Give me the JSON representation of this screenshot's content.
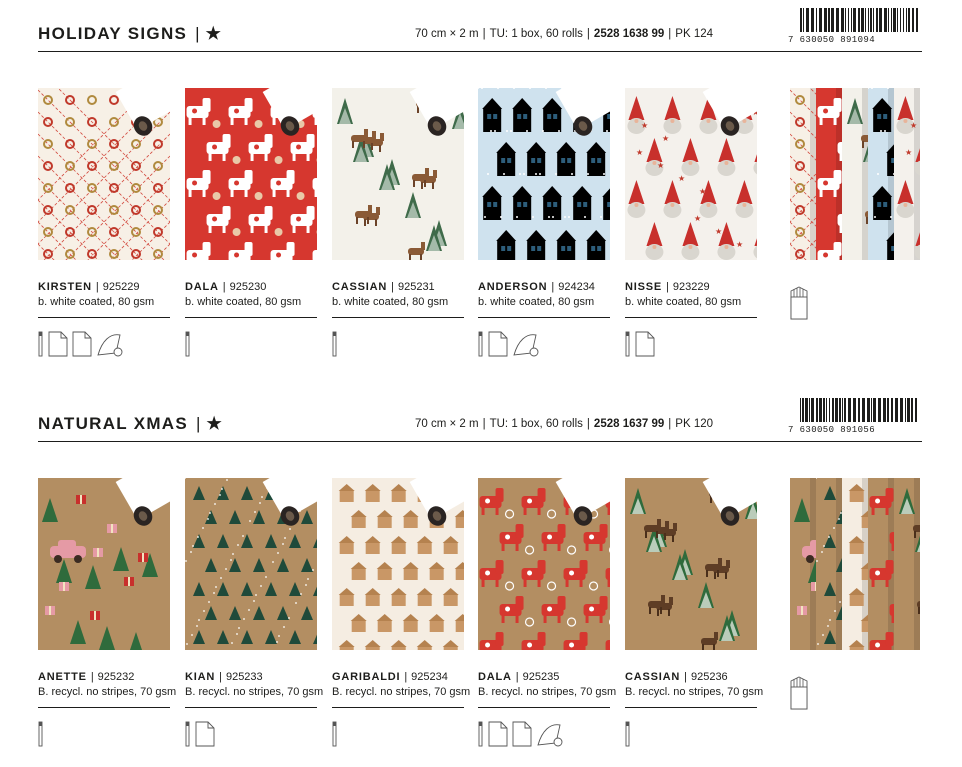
{
  "sections": [
    {
      "title": "HOLIDAY SIGNS",
      "info_size": "70 cm × 2 m",
      "info_tu": "TU: 1 box, 60 rolls",
      "info_code": "2528 1638 99",
      "info_pk": "PK 124",
      "barcode_digits": "7 630050 891094",
      "products": [
        {
          "name": "KIRSTEN",
          "code": "925229",
          "desc": "b. white coated, 80 gsm",
          "bg": "#f7f0e6",
          "icons": [
            "roll-icon",
            "sheet-icon",
            "sheet-icon",
            "bag-icon"
          ]
        },
        {
          "name": "DALA",
          "code": "925230",
          "desc": "b. white coated, 80 gsm",
          "bg": "#d6372f",
          "icons": [
            "roll-icon"
          ]
        },
        {
          "name": "CASSIAN",
          "code": "925231",
          "desc": "b. white coated, 80 gsm",
          "bg": "#f3f1ea",
          "icons": [
            "roll-icon"
          ]
        },
        {
          "name": "ANDERSON",
          "code": "924234",
          "desc": "b. white coated, 80 gsm",
          "bg": "#cfe2ee",
          "icons": [
            "roll-icon",
            "sheet-icon",
            "bag-icon"
          ]
        },
        {
          "name": "NISSE",
          "code": "923229",
          "desc": "b. white coated, 80 gsm",
          "bg": "#f4f1ec",
          "icons": [
            "roll-icon",
            "sheet-icon"
          ]
        }
      ]
    },
    {
      "title": "NATURAL XMAS",
      "info_size": "70 cm × 2 m",
      "info_tu": "TU: 1 box, 60 rolls",
      "info_code": "2528 1637 99",
      "info_pk": "PK 120",
      "barcode_digits": "7 630050 891056",
      "products": [
        {
          "name": "ANETTE",
          "code": "925232",
          "desc": "B. recycl. no stripes, 70 gsm",
          "bg": "#b38e62",
          "icons": [
            "roll-icon"
          ]
        },
        {
          "name": "KIAN",
          "code": "925233",
          "desc": "B. recycl. no stripes, 70 gsm",
          "bg": "#b38e62",
          "icons": [
            "roll-icon",
            "sheet-icon"
          ]
        },
        {
          "name": "GARIBALDI",
          "code": "925234",
          "desc": "B. recycl. no stripes, 70 gsm",
          "bg": "#f5ede2",
          "icons": [
            "roll-icon"
          ]
        },
        {
          "name": "DALA",
          "code": "925235",
          "desc": "B. recycl. no stripes, 70 gsm",
          "bg": "#b38e62",
          "icons": [
            "roll-icon",
            "sheet-icon",
            "sheet-icon",
            "bag-icon"
          ]
        },
        {
          "name": "CASSIAN",
          "code": "925236",
          "desc": "B. recycl. no stripes, 70 gsm",
          "bg": "#b38e62",
          "icons": [
            "roll-icon"
          ]
        }
      ]
    }
  ]
}
